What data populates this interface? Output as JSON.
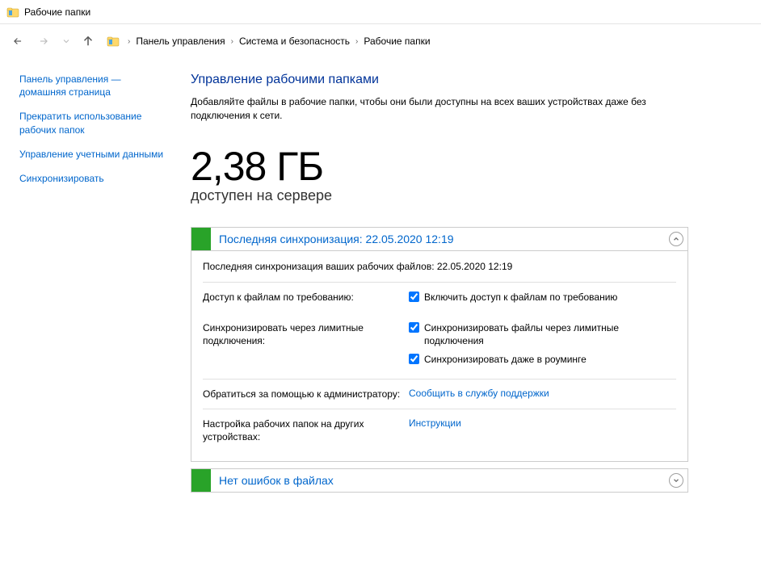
{
  "window": {
    "title": "Рабочие папки"
  },
  "breadcrumb": {
    "items": [
      "Панель управления",
      "Система и безопасность",
      "Рабочие папки"
    ]
  },
  "sidebar": {
    "home": "Панель управления — домашняя страница",
    "stop": "Прекратить использование рабочих папок",
    "creds": "Управление учетными данными",
    "sync": "Синхронизировать"
  },
  "main": {
    "heading": "Управление рабочими папками",
    "description": "Добавляйте файлы в рабочие папки, чтобы они были доступны на всех ваших устройствах даже без подключения к сети.",
    "big_value": "2,38 ГБ",
    "big_caption": "доступен на сервере"
  },
  "panel_sync": {
    "title": "Последняя синхронизация: 22.05.2020 12:19",
    "line": "Последняя синхронизация ваших рабочих файлов: 22.05.2020 12:19",
    "row_access_label": "Доступ к файлам по требованию:",
    "chk_access": "Включить доступ к файлам по требованию",
    "row_metered_label": "Синхронизировать через лимитные подключения:",
    "chk_metered": "Синхронизировать файлы через лимитные подключения",
    "chk_roaming": "Синхронизировать даже в роуминге",
    "row_help_label": "Обратиться за помощью к администратору:",
    "link_support": "Сообщить в службу поддержки",
    "row_other_label": "Настройка рабочих папок на других устройствах:",
    "link_instr": "Инструкции"
  },
  "panel_errors": {
    "title": "Нет ошибок в файлах"
  }
}
